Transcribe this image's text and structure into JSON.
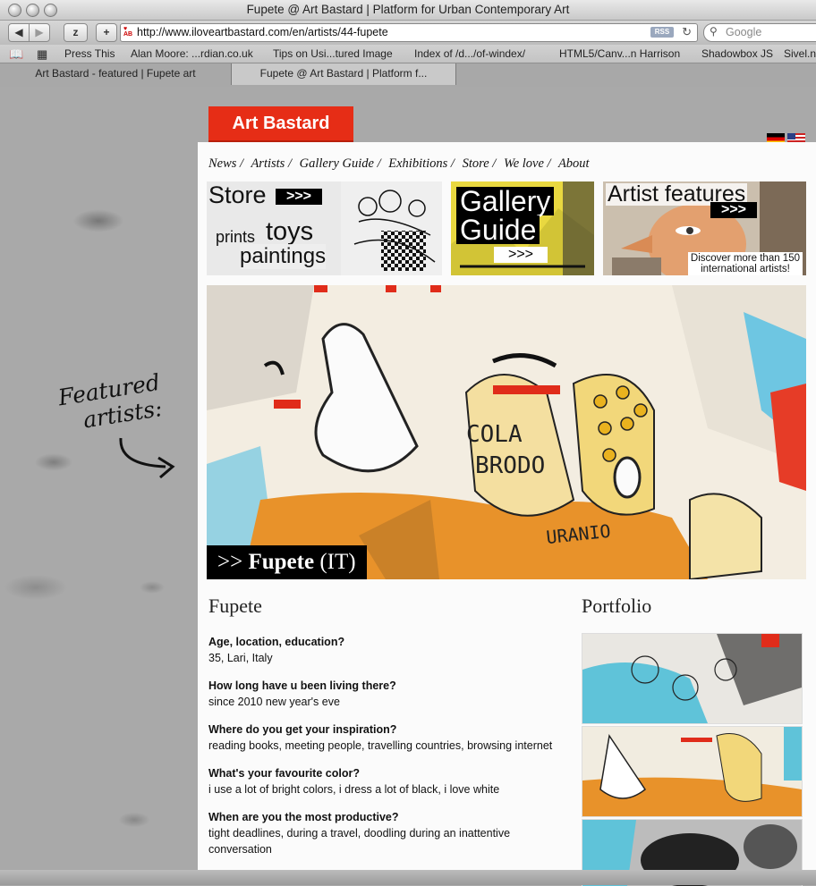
{
  "window": {
    "title": "Fupete @ Art Bastard | Platform for Urban Contemporary Art"
  },
  "toolbar": {
    "back_label": "◀",
    "forward_label": "▶",
    "topsites_label": "z",
    "add_label": "+",
    "url": "http://www.iloveartbastard.com/en/artists/44-fupete",
    "rss_label": "RSS",
    "search_placeholder": "Google"
  },
  "bookmarks": [
    "Press This",
    "Alan Moore: ...rdian.co.uk",
    "Tips on Usi...tured Image",
    "Index of /d.../of-windex/",
    "HTML5/Canv...n Harrison",
    "Shadowbox JS",
    "Sivel.n"
  ],
  "tabs": [
    {
      "label": "Art Bastard - featured | Fupete art",
      "active": false
    },
    {
      "label": "Fupete @ Art Bastard | Platform f...",
      "active": true
    }
  ],
  "site": {
    "logo": "Art Bastard",
    "nav": [
      "News /",
      "Artists /",
      "Gallery Guide /",
      "Exhibitions /",
      "Store /",
      "We love /",
      "About"
    ],
    "featured_label_1": "Featured",
    "featured_label_2": "artists:"
  },
  "promos": {
    "store": {
      "title": "Store",
      "arrows": ">>>",
      "line1_small": "prints",
      "line1_big": "toys",
      "line2": "paintings"
    },
    "gallery": {
      "line1": "Gallery",
      "line2": "Guide",
      "arrows": ">>>"
    },
    "artist": {
      "title": "Artist features",
      "arrows": ">>>",
      "caption_1": "Discover more than 150",
      "caption_2": "international artists!"
    }
  },
  "hero": {
    "caption_prefix": ">> ",
    "caption_name": "Fupete",
    "caption_country": " (IT)",
    "art_text_1": "COLA",
    "art_text_2": "BRODO",
    "art_text_3": "URANIO"
  },
  "artist": {
    "name": "Fupete",
    "qa": [
      {
        "q": "Age, location, education?",
        "a": "35, Lari, Italy"
      },
      {
        "q": "How long have u been living there?",
        "a": "since 2010 new year's eve"
      },
      {
        "q": "Where do you get your inspiration?",
        "a": "reading books, meeting people, travelling countries, browsing internet"
      },
      {
        "q": "What's your favourite color?",
        "a": "i use a lot of bright colors, i dress a lot of black, i love white"
      },
      {
        "q": "When are you the most productive?",
        "a": "tight deadlines, during a travel, doodling during an inattentive conversation"
      }
    ]
  },
  "portfolio": {
    "title": "Portfolio"
  },
  "colors": {
    "brand_red": "#e62d16",
    "orange": "#e8922a"
  }
}
